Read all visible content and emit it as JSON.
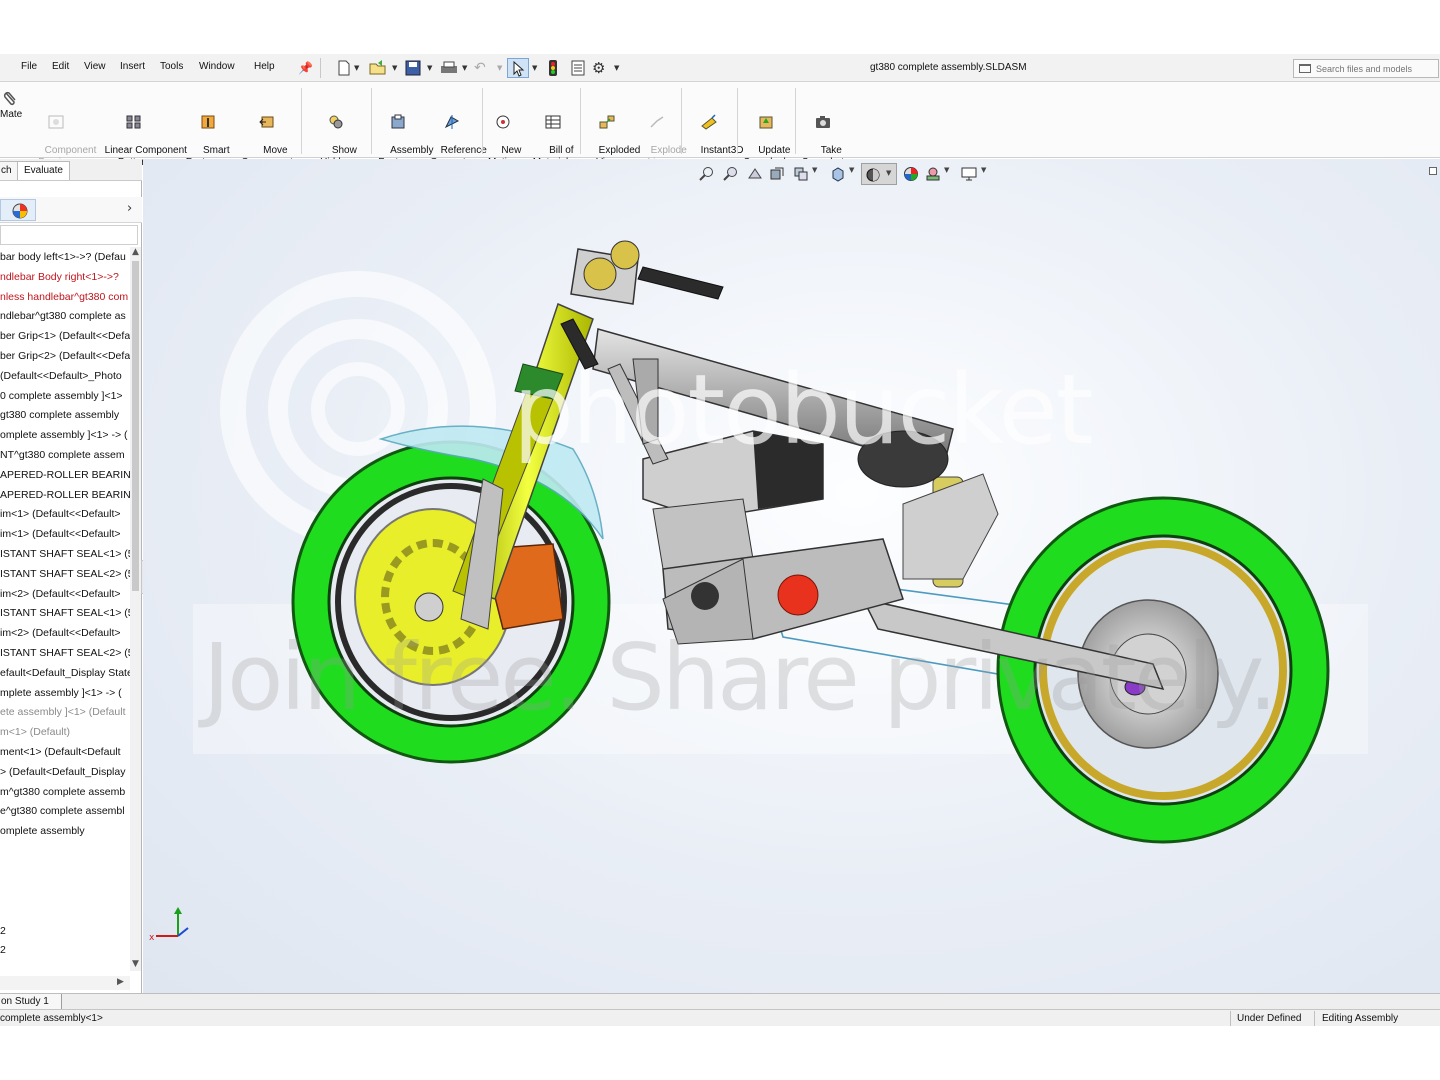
{
  "menu": {
    "items": [
      "File",
      "Edit",
      "View",
      "Insert",
      "Tools",
      "Window",
      "Help"
    ],
    "document_title": "gt380 complete assembly.SLDASM",
    "search": {
      "placeholder": "Search files and models"
    }
  },
  "ribbon": {
    "mate": "Mate",
    "component_preview": "Component\nPreview\nWindow",
    "linear_pattern": "Linear Component\nPattern",
    "smart_fasteners": "Smart\nFasteners",
    "move_component": "Move\nComponent",
    "show_hidden": "Show\nHidden\nComponents",
    "assembly_features": "Assembly\nFeatures",
    "reference_geometry": "Reference\nGeometry",
    "new_motion_study": "New\nMotion\nStudy",
    "bill_of_materials": "Bill of\nMaterials",
    "exploded_view": "Exploded\nView",
    "explode_line_sketch": "Explode\nLine\nSketch",
    "instant3d": "Instant3D",
    "update_speedpak": "Update\nSpeedpak",
    "take_snapshot": "Take\nSnapshot"
  },
  "tabs": {
    "sketch_partial": "ch",
    "evaluate": "Evaluate"
  },
  "tree": [
    {
      "text": "bar body left<1>->? (Defau",
      "style": "normal"
    },
    {
      "text": "ndlebar Body right<1>->?",
      "style": "red"
    },
    {
      "text": "nless handlebar^gt380 com",
      "style": "red"
    },
    {
      "text": "ndlebar^gt380 complete as",
      "style": "normal"
    },
    {
      "text": "ber Grip<1> (Default<<Defa",
      "style": "normal"
    },
    {
      "text": "ber Grip<2> (Default<<Defa",
      "style": "normal"
    },
    {
      "text": "(Default<<Default>_Photo",
      "style": "normal"
    },
    {
      "text": "0 complete assembly ]<1>",
      "style": "normal"
    },
    {
      "text": "gt380 complete assembly",
      "style": "normal"
    },
    {
      "text": "omplete assembly ]<1> -> (",
      "style": "normal"
    },
    {
      "text": "NT^gt380 complete assem",
      "style": "normal"
    },
    {
      "text": "APERED-ROLLER BEARING-",
      "style": "normal"
    },
    {
      "text": "APERED-ROLLER BEARING-",
      "style": "normal"
    },
    {
      "text": "im<1> (Default<<Default>",
      "style": "normal"
    },
    {
      "text": "im<1> (Default<<Default>",
      "style": "normal"
    },
    {
      "text": "ISTANT SHAFT SEAL<1> (5",
      "style": "normal"
    },
    {
      "text": "ISTANT SHAFT SEAL<2> (5",
      "style": "normal"
    },
    {
      "text": "im<2> (Default<<Default>",
      "style": "normal"
    },
    {
      "text": "ISTANT SHAFT SEAL<1> (5",
      "style": "normal"
    },
    {
      "text": "im<2> (Default<<Default>",
      "style": "normal"
    },
    {
      "text": "ISTANT SHAFT SEAL<2> (5",
      "style": "normal"
    },
    {
      "text": "efault<Default_Display State",
      "style": "normal"
    },
    {
      "text": "mplete assembly ]<1> -> (",
      "style": "normal"
    },
    {
      "text": "ete assembly ]<1> (Default",
      "style": "gray"
    },
    {
      "text": "m<1> (Default)",
      "style": "gray"
    },
    {
      "text": "ment<1> (Default<Default",
      "style": "normal"
    },
    {
      "text": "> (Default<Default_Display",
      "style": "normal"
    },
    {
      "text": "m^gt380 complete assemb",
      "style": "normal"
    },
    {
      "text": "e^gt380 complete assembl",
      "style": "normal"
    },
    {
      "text": "omplete assembly",
      "style": "normal"
    }
  ],
  "tree_extra": [
    "2",
    "2"
  ],
  "watermark": {
    "logo": "photobucket",
    "tagline": "Join free. Share privately."
  },
  "motion_tab": "on Study 1",
  "status": {
    "component": "complete assembly<1>",
    "definition": "Under Defined",
    "mode": "Editing Assembly"
  },
  "colors": {
    "tire": "#1fdc1f",
    "rim_gold": "#c8a82a",
    "fork_yellow": "#d9e600",
    "caliper": "#e06a1c",
    "frame_gray": "#bcbcbc",
    "sprocket_red": "#e8321e"
  }
}
